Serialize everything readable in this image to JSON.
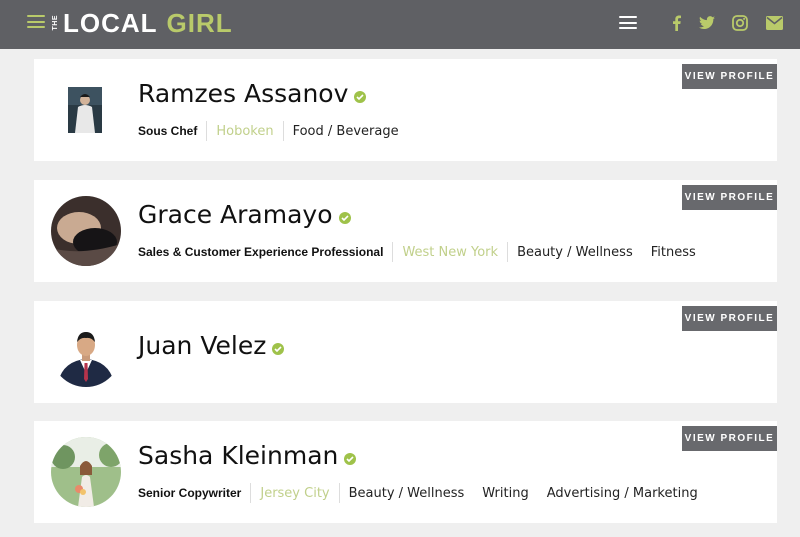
{
  "header": {
    "logo_the": "THE",
    "logo_local": "LOCAL",
    "logo_girl": "GIRL",
    "social_icons": [
      "facebook-icon",
      "twitter-icon",
      "instagram-icon",
      "email-icon"
    ],
    "colors": {
      "bar": "#5f6064",
      "accent": "#b9ca6a"
    }
  },
  "profiles": [
    {
      "name": "Ramzes Assanov",
      "role": "Sous Chef",
      "location": "Hoboken",
      "tags": [
        "Food / Beverage"
      ],
      "button": "VIEW PROFILE"
    },
    {
      "name": "Grace Aramayo",
      "role": "Sales & Customer Experience Professional",
      "location": "West New York",
      "tags": [
        "Beauty / Wellness",
        "Fitness"
      ],
      "button": "VIEW PROFILE"
    },
    {
      "name": "Juan Velez",
      "button": "VIEW PROFILE"
    },
    {
      "name": "Sasha Kleinman",
      "role": "Senior Copywriter",
      "location": "Jersey City",
      "tags": [
        "Beauty / Wellness",
        "Writing",
        "Advertising / Marketing"
      ],
      "button": "VIEW PROFILE"
    }
  ],
  "colors": {
    "verified": "#9fc24a",
    "location_text": "#c1d08b",
    "button_bg": "#68696d",
    "page_bg": "#efefef"
  }
}
